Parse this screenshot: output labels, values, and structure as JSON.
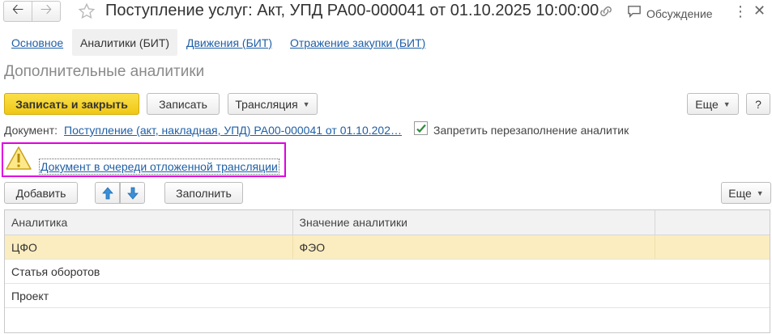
{
  "window": {
    "title": "Поступление услуг: Акт, УПД РА00-000041 от 01.10.2025 10:00:00",
    "discussion_label": "Обсуждение"
  },
  "tabs": [
    {
      "label": "Основное",
      "active": false
    },
    {
      "label": "Аналитики (БИТ)",
      "active": true
    },
    {
      "label": "Движения (БИТ)",
      "active": false
    },
    {
      "label": "Отражение закупки (БИТ)",
      "active": false
    }
  ],
  "section": {
    "title": "Дополнительные аналитики"
  },
  "toolbar": {
    "save_close_label": "Записать и закрыть",
    "save_label": "Записать",
    "translation_label": "Трансляция",
    "more_label": "Еще",
    "help_label": "?"
  },
  "document": {
    "label": "Документ:",
    "link": "Поступление (акт, накладная, УПД) РА00-000041 от 01.10.202…",
    "prevent_refill_label": "Запретить перезаполнение аналитик",
    "prevent_refill_checked": true
  },
  "warning": {
    "text": "Документ в очереди отложенной трансляции"
  },
  "table_toolbar": {
    "add_label": "Добавить",
    "fill_label": "Заполнить",
    "more_label": "Еще"
  },
  "table": {
    "columns": [
      "Аналитика",
      "Значение аналитики",
      ""
    ],
    "rows": [
      {
        "analytic": "ЦФО",
        "value": "ФЭО",
        "selected": true
      },
      {
        "analytic": "Статья оборотов",
        "value": "",
        "selected": false
      },
      {
        "analytic": "Проект",
        "value": "",
        "selected": false
      }
    ]
  },
  "colors": {
    "primary_button": "#f5d21e",
    "link": "#1f5fa6",
    "selected_row": "#fbedc0",
    "warning_highlight": "#e100e1"
  }
}
